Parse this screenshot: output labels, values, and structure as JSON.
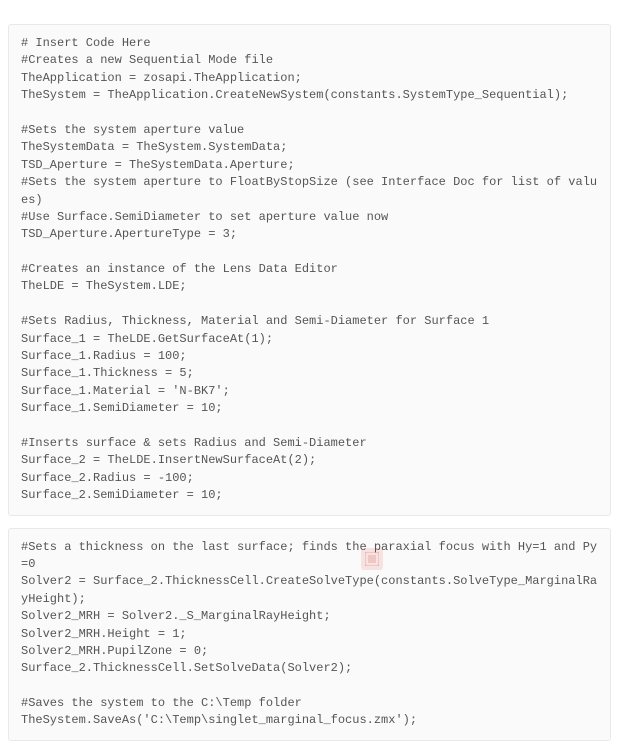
{
  "block1": {
    "text": "# Insert Code Here\n#Creates a new Sequential Mode file\nTheApplication = zosapi.TheApplication;\nTheSystem = TheApplication.CreateNewSystem(constants.SystemType_Sequential);\n\n#Sets the system aperture value\nTheSystemData = TheSystem.SystemData;\nTSD_Aperture = TheSystemData.Aperture;\n#Sets the system aperture to FloatByStopSize (see Interface Doc for list of values)\n#Use Surface.SemiDiameter to set aperture value now\nTSD_Aperture.ApertureType = 3;\n\n#Creates an instance of the Lens Data Editor\nTheLDE = TheSystem.LDE;\n\n#Sets Radius, Thickness, Material and Semi-Diameter for Surface 1\nSurface_1 = TheLDE.GetSurfaceAt(1);\nSurface_1.Radius = 100;\nSurface_1.Thickness = 5;\nSurface_1.Material = 'N-BK7';\nSurface_1.SemiDiameter = 10;\n\n#Inserts surface & sets Radius and Semi-Diameter\nSurface_2 = TheLDE.InsertNewSurfaceAt(2);\nSurface_2.Radius = -100;\nSurface_2.SemiDiameter = 10;"
  },
  "block2": {
    "text": "#Sets a thickness on the last surface; finds the paraxial focus with Hy=1 and Py=0\nSolver2 = Surface_2.ThicknessCell.CreateSolveType(constants.SolveType_MarginalRayHeight);\nSolver2_MRH = Solver2._S_MarginalRayHeight;\nSolver2_MRH.Height = 1;\nSolver2_MRH.PupilZone = 0;\nSurface_2.ThicknessCell.SetSolveData(Solver2);\n\n#Saves the system to the C:\\Temp folder\nTheSystem.SaveAs('C:\\Temp\\singlet_marginal_focus.zmx');"
  }
}
